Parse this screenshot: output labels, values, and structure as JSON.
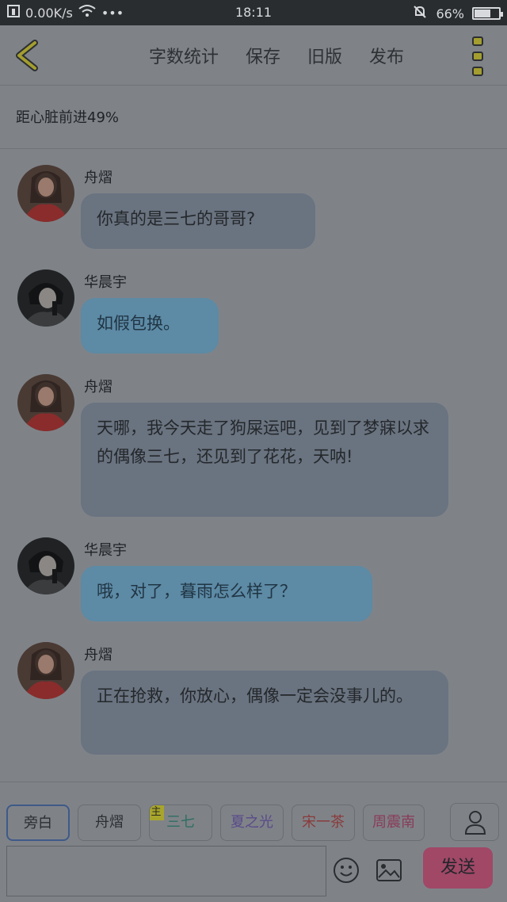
{
  "status": {
    "speed": "0.00K/s",
    "dots": "•••",
    "time": "18:11",
    "battery": "66%"
  },
  "toolbar": {
    "items": [
      "字数统计",
      "保存",
      "旧版",
      "发布"
    ]
  },
  "progress": "距心脏前进49%",
  "messages": [
    {
      "sender": "舟熠",
      "text": "你真的是三七的哥哥?",
      "style": "gray"
    },
    {
      "sender": "华晨宇",
      "text": "如假包换。",
      "style": "blue"
    },
    {
      "sender": "舟熠",
      "text": "天哪，我今天走了狗屎运吧，见到了梦寐以求的偶像三七，还见到了花花，天呐!",
      "style": "gray"
    },
    {
      "sender": "华晨宇",
      "text": "哦，对了，暮雨怎么样了？",
      "style": "blue"
    },
    {
      "sender": "舟熠",
      "text": "正在抢救，你放心，偶像一定会没事儿的。",
      "style": "gray"
    }
  ],
  "characters": [
    {
      "label": "旁白",
      "color": "#2b2f32"
    },
    {
      "label": "舟熠",
      "color": "#2b2f32"
    },
    {
      "label": "三七",
      "color": "#2f6e62",
      "badge": "主"
    },
    {
      "label": "夏之光",
      "color": "#5a4a8a"
    },
    {
      "label": "宋一茶",
      "color": "#8a3b3b"
    },
    {
      "label": "周震南",
      "color": "#8a3b58"
    }
  ],
  "composer": {
    "placeholder": "",
    "send_label": "发送"
  },
  "colors": {
    "bubble_gray": "#6a7380",
    "bubble_blue": "#5d8aa5",
    "send_button": "#a04866",
    "main_badge": "#a8a52d"
  }
}
